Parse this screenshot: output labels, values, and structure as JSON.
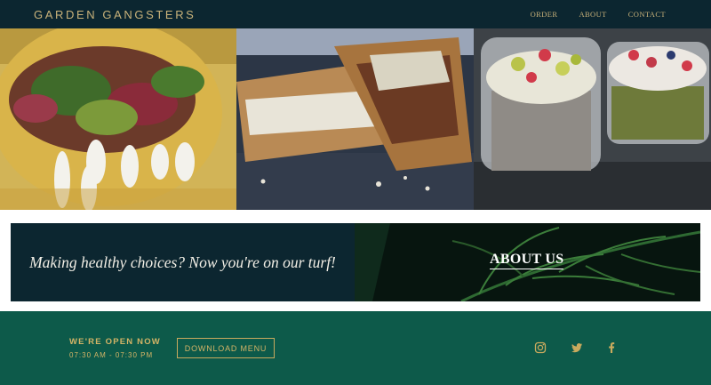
{
  "header": {
    "brand": "GARDEN GANGSTERS",
    "nav": [
      "ORDER",
      "ABOUT",
      "CONTACT"
    ]
  },
  "gallery": {
    "photos": [
      "tacos-photo",
      "grilled-sandwich-photo",
      "fruit-parfait-cups-photo"
    ]
  },
  "banner": {
    "tagline": "Making healthy choices? Now you're on our turf!",
    "about_link": "ABOUT US"
  },
  "footer": {
    "open_title": "WE'RE OPEN NOW",
    "hours": "07:30 AM - 07:30 PM",
    "download_label": "DOWNLOAD MENU",
    "social_icons": [
      "instagram-icon",
      "twitter-icon",
      "facebook-icon"
    ]
  },
  "colors": {
    "header_bg": "#0c2630",
    "gold": "#c9b27a",
    "footer_bg": "#0d5a4a",
    "banner_dark": "#0c2630"
  }
}
